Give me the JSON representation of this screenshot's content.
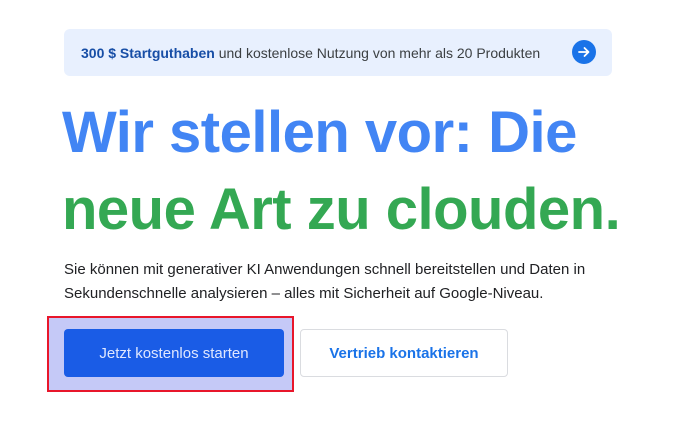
{
  "promo": {
    "strong_text": "300 $ Startguthaben",
    "rest_text": " und kostenlose Nutzung von mehr als 20 Produkten",
    "arrow_icon": "arrow-right-icon"
  },
  "hero": {
    "headline_line1": "Wir stellen vor: Die",
    "headline_line2": "neue Art zu clouden.",
    "subtitle": "Sie können mit generativer KI Anwendungen schnell bereitstellen und Daten in Sekundenschnelle analysieren – alles mit Sicherheit auf Google-Niveau."
  },
  "buttons": {
    "primary_label": "Jetzt kostenlos starten",
    "secondary_label": "Vertrieb kontaktieren"
  },
  "colors": {
    "headline_blue": "#4285f4",
    "headline_green": "#34a853",
    "primary_button": "#1a5ce6",
    "highlight_border": "#e8162b"
  }
}
